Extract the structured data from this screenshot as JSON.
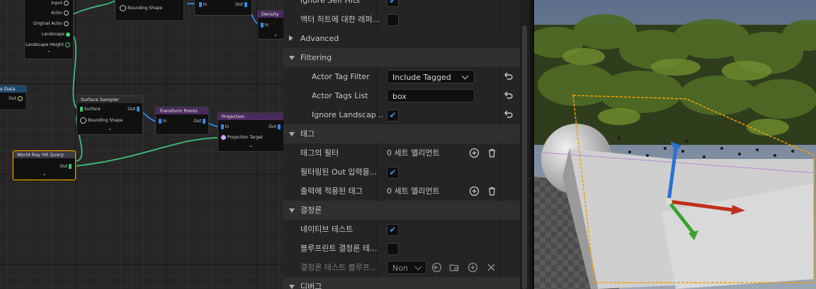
{
  "graph": {
    "top_node": {
      "pins": [
        "Input",
        "Actor",
        "Original Actor",
        "Landscape",
        "Landscape Height"
      ]
    },
    "bounding_node": {
      "pin": "Bounding Shape"
    },
    "mid_node": {
      "pin_in": "In",
      "pin_out": "Out"
    },
    "density_node": {
      "title": "Density",
      "pin_in": "In"
    },
    "data_node": {
      "title": "e Data",
      "pin_out": "Out"
    },
    "surface_sampler": {
      "title": "Surface Sampler",
      "pin_surface": "Surface",
      "pin_out": "Out",
      "pin_bounding": "Bounding Shape"
    },
    "transform_points": {
      "title": "Transform Points",
      "pin_in": "In",
      "pin_out": "Out"
    },
    "projection": {
      "title": "Projection",
      "pin_in": "In",
      "pin_out": "Out",
      "pin_target": "Projection Target"
    },
    "world_ray": {
      "title": "World Ray Hit Query",
      "pin_out": "Out"
    }
  },
  "details": {
    "rows": {
      "ignore_self_hits": {
        "label": "Ignore Self Hits",
        "checked": true
      },
      "actor_hit_ref": {
        "label": "액터 히트에 대한 레퍼...",
        "checked": false
      },
      "advanced": {
        "label": "Advanced"
      },
      "filtering": {
        "label": "Filtering"
      },
      "actor_tag_filter": {
        "label": "Actor Tag Filter",
        "value": "Include Tagged"
      },
      "actor_tags_list": {
        "label": "Actor Tags List",
        "value": "box"
      },
      "ignore_landscape": {
        "label": "Ignore Landscap...",
        "checked": true
      },
      "tags_section": {
        "label": "태그"
      },
      "tag_filter": {
        "label": "태그의 필터",
        "value": "0 세트 엘리먼트"
      },
      "filtered_out_input": {
        "label": "필터링된 Out 입력을...",
        "checked": true
      },
      "output_tags": {
        "label": "출력에 적용된 태그",
        "value": "0 세트 엘리먼트"
      },
      "determinism_section": {
        "label": "결정론"
      },
      "native_test": {
        "label": "네이티브 테스트",
        "checked": true
      },
      "blueprint_test": {
        "label": "블루프린트 결정론 테...",
        "checked": false
      },
      "blueprint_test_detail": {
        "label": "결정론 테스트 블루프...",
        "value": "Non"
      },
      "debug_section": {
        "label": "디버그"
      }
    },
    "icons": {
      "reset": "reset-arrow-icon",
      "add": "plus-circle-icon",
      "trash": "trash-icon",
      "browse": "browse-icon",
      "clear": "close-icon"
    }
  },
  "colors": {
    "accent": "#3d8ef5",
    "selection": "#f0a000",
    "wire_green": "#3fbf7f",
    "wire_blue": "#2f8cf0"
  }
}
